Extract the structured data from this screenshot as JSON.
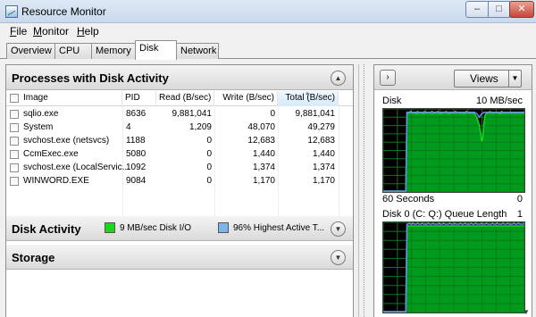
{
  "window": {
    "title": "Resource Monitor",
    "controls": {
      "minimize": "–",
      "maximize": "□",
      "close": "✕"
    }
  },
  "menu": [
    {
      "label": "File",
      "mnemonic": "F",
      "rest": "ile"
    },
    {
      "label": "Monitor",
      "mnemonic": "M",
      "rest": "onitor"
    },
    {
      "label": "Help",
      "mnemonic": "H",
      "rest": "elp"
    }
  ],
  "tabs": [
    "Overview",
    "CPU",
    "Memory",
    "Disk",
    "Network"
  ],
  "active_tab": "Disk",
  "processes": {
    "title": "Processes with Disk Activity",
    "columns": [
      "Image",
      "PID",
      "Read (B/sec)",
      "Write (B/sec)",
      "Total (B/sec)"
    ],
    "sorted_column": "Total (B/sec)",
    "rows": [
      {
        "image": "sqlio.exe",
        "pid": "8636",
        "read": "9,881,041",
        "write": "0",
        "total": "9,881,041"
      },
      {
        "image": "System",
        "pid": "4",
        "read": "1,209",
        "write": "48,070",
        "total": "49,279"
      },
      {
        "image": "svchost.exe (netsvcs)",
        "pid": "1188",
        "read": "0",
        "write": "12,683",
        "total": "12,683"
      },
      {
        "image": "CcmExec.exe",
        "pid": "5080",
        "read": "0",
        "write": "1,440",
        "total": "1,440"
      },
      {
        "image": "svchost.exe (LocalServic...",
        "pid": "1092",
        "read": "0",
        "write": "1,374",
        "total": "1,374"
      },
      {
        "image": "WINWORD.EXE",
        "pid": "9084",
        "read": "0",
        "write": "1,170",
        "total": "1,170"
      }
    ]
  },
  "disk_activity": {
    "title": "Disk Activity",
    "legend": [
      {
        "text": "9 MB/sec Disk I/O",
        "color": "#1ed51e"
      },
      {
        "text": "96% Highest Active T...",
        "color": "#7fb6ea"
      }
    ]
  },
  "storage": {
    "title": "Storage"
  },
  "side": {
    "views_label": "Views",
    "graphs": [
      {
        "name": "Disk",
        "scale_max": "10 MB/sec",
        "footer_left": "60 Seconds",
        "footer_right": "0",
        "green": [
          0,
          0,
          0,
          0,
          0,
          0,
          0,
          0,
          0,
          0,
          0,
          0,
          0,
          0,
          0,
          0,
          0,
          0,
          0,
          0,
          9.6,
          9.7,
          9.6,
          9.7,
          9.6,
          9.7,
          9.6,
          9.6,
          9.5,
          9.6,
          9.6,
          9.7,
          9.6,
          9.6,
          9.5,
          9.6,
          9.6,
          9.6,
          9.7,
          9.6,
          9.6,
          9.5,
          9.6,
          9.6,
          9.6,
          9.7,
          9.6,
          9.6,
          9.5,
          9.6,
          9.6,
          9.6,
          9.7,
          9.6,
          9.6,
          9.6,
          9.5,
          9.6,
          9.7,
          9.6,
          9.6,
          9.6,
          9.6,
          9.7,
          9.6,
          9.6,
          9.6,
          9.6,
          9.5,
          9.6,
          9.6,
          9.7,
          9.6,
          9.6,
          9.6,
          9.6,
          9.6,
          9.5,
          9.3,
          9.0,
          8.6,
          8.1,
          7.3,
          6.1,
          6.6,
          8.5,
          9.4,
          9.6,
          9.6,
          9.7,
          9.6,
          9.6,
          9.6,
          9.6,
          9.6,
          9.7,
          9.6,
          9.6,
          9.6,
          9.5,
          9.6,
          9.6,
          9.6,
          9.6,
          9.6,
          9.7,
          9.6,
          9.6,
          9.6,
          9.6,
          9.6,
          9.6,
          9.6,
          9.6,
          9.6,
          9.6,
          9.6,
          9.6,
          9.6,
          9.6
        ],
        "blue": [
          0,
          0,
          0,
          0,
          0,
          0,
          0,
          0,
          0,
          0,
          0,
          0,
          0,
          0,
          0,
          0,
          0,
          0,
          0,
          0,
          9.7,
          9.7,
          9.7,
          9.8,
          9.7,
          9.7,
          9.7,
          9.7,
          9.7,
          9.8,
          9.7,
          9.7,
          9.7,
          9.7,
          9.7,
          9.8,
          9.7,
          9.7,
          9.7,
          9.7,
          9.7,
          9.8,
          9.7,
          9.7,
          9.7,
          9.7,
          9.8,
          9.7,
          9.7,
          9.7,
          9.7,
          9.7,
          9.7,
          9.8,
          9.7,
          9.7,
          9.7,
          9.7,
          9.7,
          9.7,
          9.7,
          9.8,
          9.7,
          9.7,
          9.7,
          9.7,
          9.7,
          9.7,
          9.7,
          9.7,
          9.8,
          9.7,
          9.7,
          9.7,
          9.7,
          9.7,
          9.7,
          9.7,
          9.6,
          9.5,
          9.3,
          9.1,
          9.3,
          9.5,
          9.6,
          9.7,
          9.7,
          9.7,
          9.7,
          9.7,
          9.8,
          9.7,
          9.7,
          9.7,
          9.7,
          9.7,
          9.7,
          9.7,
          9.7,
          9.7,
          9.8,
          9.7,
          9.7,
          9.7,
          9.7,
          9.7,
          9.7,
          9.7,
          9.7,
          9.7,
          9.7,
          9.7,
          9.7,
          9.7,
          9.7,
          9.7,
          9.7,
          9.7,
          9.7,
          9.7
        ],
        "max": 10
      },
      {
        "name": "Disk 0 (C: Q:) Queue Length",
        "scale_max": "1",
        "footer_left": "",
        "footer_right": "",
        "green": [
          0,
          0,
          0,
          0,
          0,
          0,
          0,
          0,
          0,
          0,
          0,
          0,
          0,
          0,
          0,
          0,
          0,
          0,
          0,
          0,
          0.97,
          0.97,
          0.97,
          0.97,
          0.97,
          0.97,
          0.97,
          0.97,
          0.97,
          0.97,
          0.97,
          0.97,
          0.97,
          0.97,
          0.97,
          0.97,
          0.97,
          0.97,
          0.97,
          0.97,
          0.97,
          0.97,
          0.97,
          0.97,
          0.97,
          0.97,
          0.97,
          0.97,
          0.97,
          0.97,
          0.97,
          0.97,
          0.97,
          0.97,
          0.97,
          0.97,
          0.97,
          0.97,
          0.97,
          0.97,
          0.97,
          0.97,
          0.97,
          0.97,
          0.97,
          0.97,
          0.97,
          0.97,
          0.97,
          0.97,
          0.97,
          0.97,
          0.97,
          0.97,
          0.97,
          0.97,
          0.97,
          0.97,
          0.97,
          0.97,
          0.97,
          0.97,
          0.97,
          0.97,
          0.97,
          0.97,
          0.97,
          0.97,
          0.97,
          0.97,
          0.97,
          0.97,
          0.97,
          0.97,
          0.97,
          0.97,
          0.97,
          0.97,
          0.97,
          0.97,
          0.97,
          0.97,
          0.97,
          0.97,
          0.97,
          0.97,
          0.97,
          0.97,
          0.97,
          0.97,
          0.97,
          0.97,
          0.97,
          0.97,
          0.97,
          0.97,
          0.97,
          0.97,
          0.97,
          0.97
        ],
        "blue": [
          0,
          0,
          0,
          0,
          0,
          0,
          0,
          0,
          0,
          0,
          0,
          0,
          0,
          0,
          0,
          0,
          0,
          0,
          0,
          0,
          0.99,
          0.99,
          1.0,
          0.99,
          0.99,
          1.0,
          0.99,
          0.99,
          0.99,
          1.0,
          0.99,
          0.99,
          0.99,
          1.0,
          0.99,
          0.99,
          0.99,
          0.99,
          1.0,
          0.99,
          0.99,
          0.99,
          1.0,
          0.99,
          0.99,
          0.99,
          0.99,
          1.0,
          0.99,
          0.99,
          0.99,
          1.0,
          0.99,
          0.99,
          0.99,
          0.99,
          1.0,
          0.99,
          0.99,
          0.99,
          1.0,
          0.99,
          0.99,
          0.99,
          0.99,
          1.0,
          0.99,
          0.99,
          0.99,
          1.0,
          0.99,
          0.99,
          0.99,
          0.99,
          1.0,
          0.99,
          0.99,
          0.99,
          1.0,
          0.99,
          0.99,
          0.99,
          0.99,
          1.0,
          0.99,
          0.99,
          0.99,
          1.0,
          0.99,
          0.99,
          0.99,
          0.99,
          1.0,
          0.99,
          0.99,
          0.99,
          1.0,
          0.99,
          0.99,
          0.99,
          0.99,
          1.0,
          0.99,
          0.99,
          0.99,
          1.0,
          0.99,
          0.99,
          0.99,
          0.99,
          1.0,
          0.99,
          0.99,
          0.99,
          1.0,
          0.99,
          0.99,
          0.99,
          0.99,
          1.0
        ],
        "max": 1
      }
    ]
  },
  "colors": {
    "graph_bg": "#000000",
    "grid": "#0a7a1a",
    "green_fill": "#009a1c",
    "green_line": "#1ed51e",
    "blue_line": "#6a8df0"
  }
}
